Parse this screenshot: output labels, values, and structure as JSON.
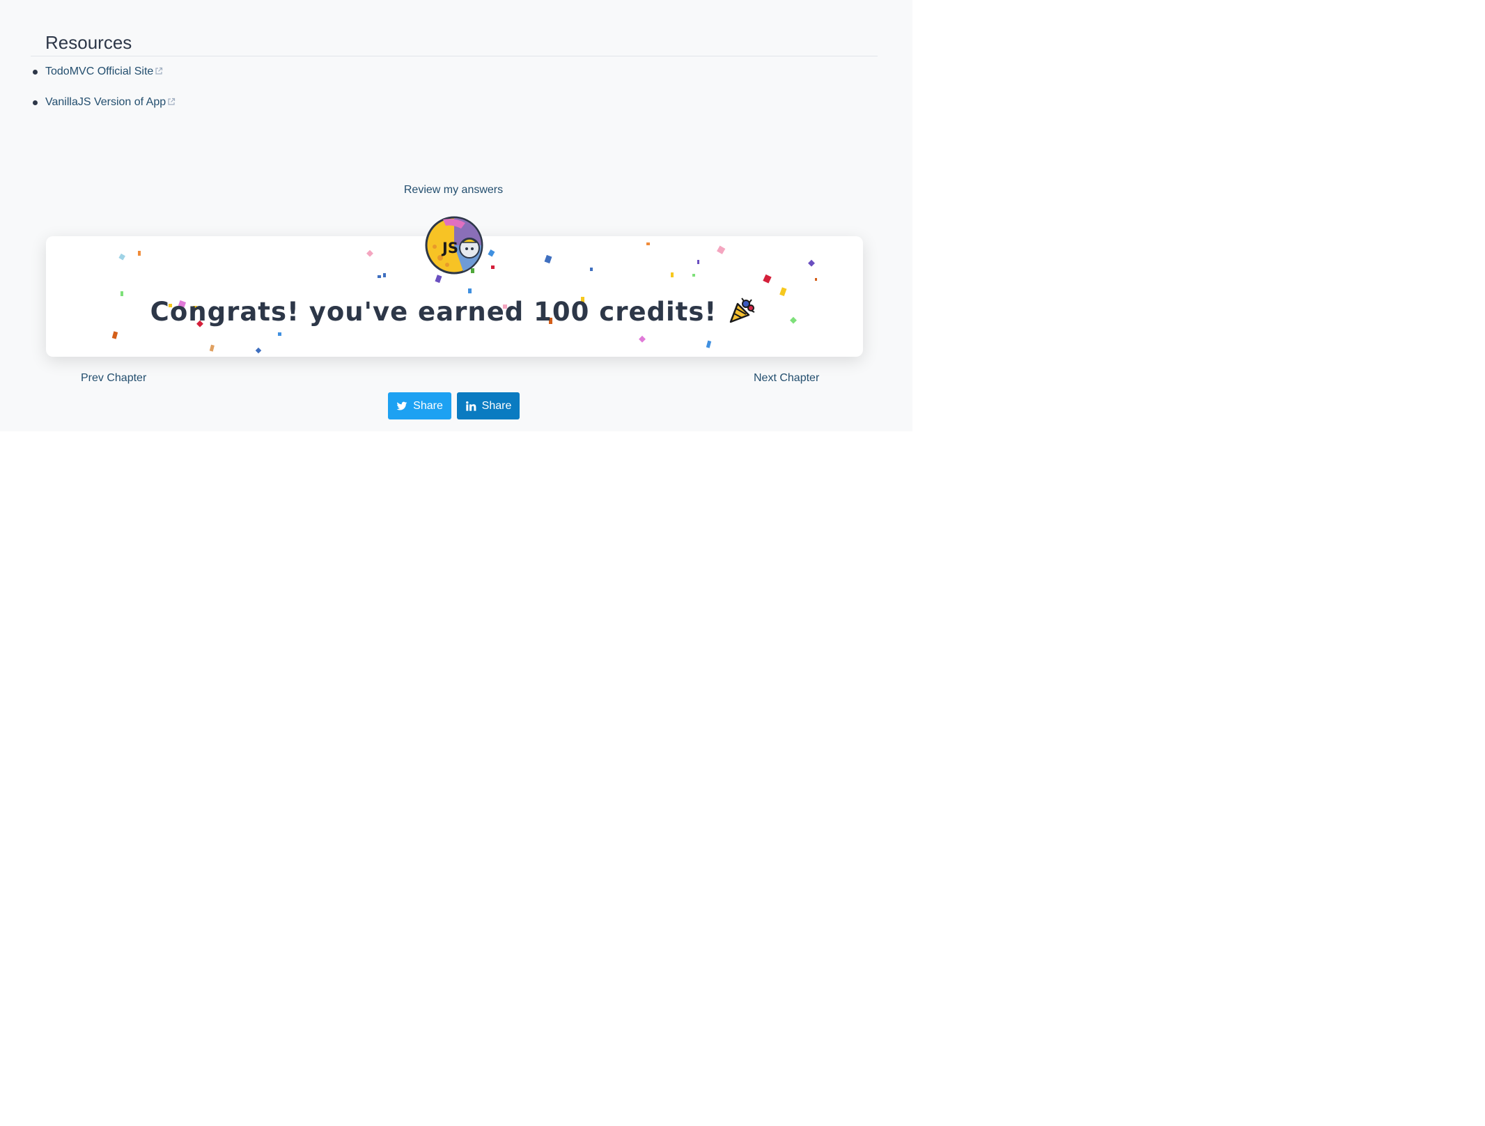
{
  "resources": {
    "title": "Resources",
    "links": [
      {
        "label": "TodoMVC Official Site"
      },
      {
        "label": "VanillaJS Version of App"
      }
    ]
  },
  "review_label": "Review my answers",
  "congrats": {
    "message": "Congrats! you've earned 100 credits!",
    "badge_text": "JS",
    "badge_icon": "js-badge-icon",
    "celebration_icon": "party-popper-icon"
  },
  "nav": {
    "prev_label": "Prev Chapter",
    "next_label": "Next Chapter"
  },
  "share": {
    "twitter_label": "Share",
    "linkedin_label": "Share"
  },
  "colors": {
    "link": "#234e6e",
    "twitter": "#1da1f2",
    "linkedin": "#0a7bc1",
    "page_bg": "#f8f9fa"
  }
}
